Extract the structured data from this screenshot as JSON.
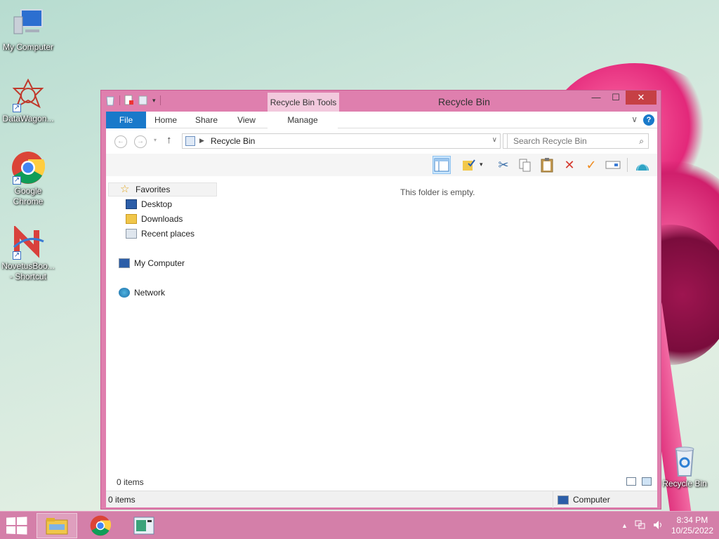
{
  "desktop": {
    "icons": [
      {
        "label": "My Computer"
      },
      {
        "label": "DataWagon..."
      },
      {
        "label": "Google Chrome"
      },
      {
        "label": "NovetusBoo... - Shortcut"
      },
      {
        "label": "Recycle Bin"
      }
    ]
  },
  "window": {
    "title": "Recycle Bin",
    "context_tab": "Recycle Bin Tools",
    "controls": {
      "minimize": "—",
      "maximize": "☐",
      "close": "✕"
    },
    "ribbon_tabs": [
      "File",
      "Home",
      "Share",
      "View",
      "Manage"
    ],
    "address": {
      "path": "Recycle Bin"
    },
    "search": {
      "placeholder": "Search Recycle Bin"
    },
    "nav": {
      "favorites": "Favorites",
      "desktop": "Desktop",
      "downloads": "Downloads",
      "recent": "Recent places",
      "computer": "My Computer",
      "network": "Network"
    },
    "empty_message": "This folder is empty.",
    "items_count": "0 items",
    "status": {
      "left": "0 items",
      "right": "Computer"
    }
  },
  "taskbar": {
    "time": "8:34 PM",
    "date": "10/25/2022"
  },
  "colors": {
    "window_frame": "#df7fae",
    "accent": "#1979ca",
    "taskbar": "#d47fa9",
    "close_button": "#c64045"
  }
}
